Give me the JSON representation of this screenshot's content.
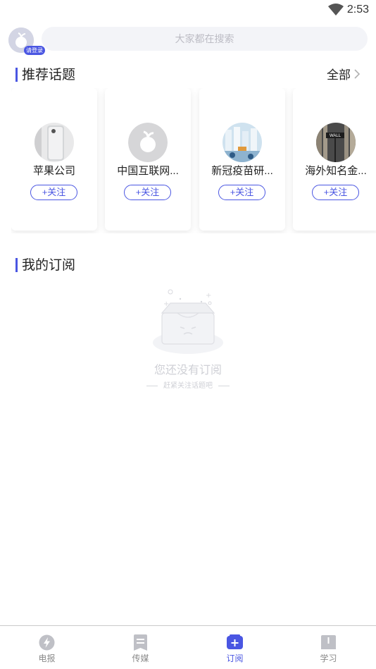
{
  "status_bar": {
    "time": "2:53",
    "wifi_icon": "wifi-icon"
  },
  "header": {
    "avatar_icon": "default-avatar-icon",
    "login_badge": "请登录",
    "search_placeholder": "大家都在搜索"
  },
  "recommended": {
    "title": "推荐话题",
    "all_label": "全部",
    "topics": [
      {
        "name": "苹果公司",
        "follow_label": "+关注",
        "image": "iphone-photo"
      },
      {
        "name": "中国互联网...",
        "follow_label": "+关注",
        "image": "placeholder-logo"
      },
      {
        "name": "新冠疫苗研...",
        "follow_label": "+关注",
        "image": "vaccine-vials-photo"
      },
      {
        "name": "海外知名金...",
        "follow_label": "+关注",
        "image": "wall-street-sign-photo"
      }
    ]
  },
  "subscriptions": {
    "title": "我的订阅",
    "empty_title": "您还没有订阅",
    "empty_subtitle": "赶紧关注话题吧"
  },
  "tabs": [
    {
      "label": "电报",
      "icon": "lightning-icon",
      "active": false
    },
    {
      "label": "传媒",
      "icon": "document-icon",
      "active": false
    },
    {
      "label": "订阅",
      "icon": "add-icon",
      "active": true
    },
    {
      "label": "学习",
      "icon": "book-icon",
      "active": false
    }
  ],
  "colors": {
    "accent": "#4a56e2",
    "inactive": "#8a8a8a",
    "placeholder": "#bcbcc4"
  }
}
